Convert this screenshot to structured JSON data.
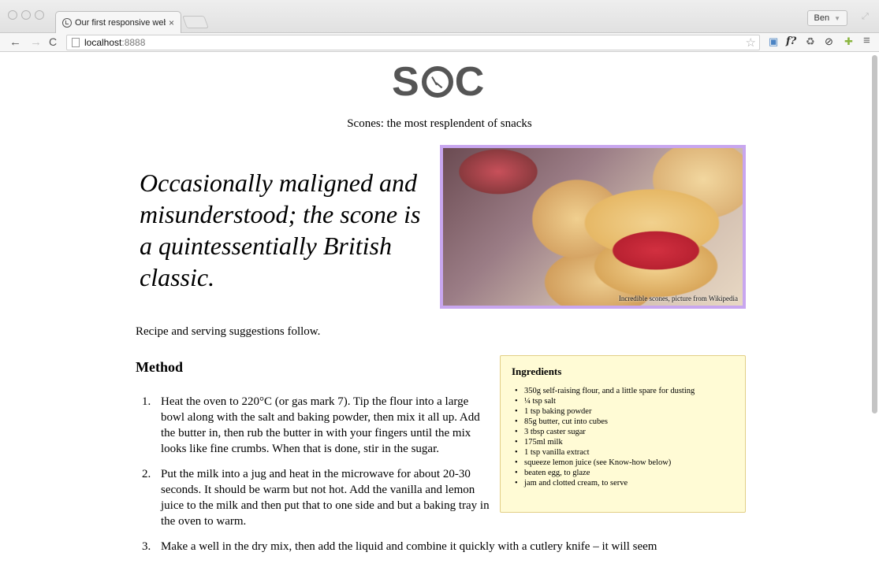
{
  "browser": {
    "tab_title": "Our first responsive web p",
    "tab_fade": "",
    "tab_close": "×",
    "user": "Ben",
    "url_host": "localhost",
    "url_port": ":8888",
    "icons": {
      "back": "back-arrow-icon",
      "forward": "forward-arrow-icon",
      "reload": "reload-icon",
      "bookmark": "star-icon",
      "menu": "hamburger-menu-icon"
    },
    "ext_label": "f?"
  },
  "page": {
    "logo": {
      "left": "S",
      "right": "C"
    },
    "tagline": "Scones: the most resplendent of snacks",
    "lede": "Occasionally maligned and misunderstood; the scone is a quintessentially British classic.",
    "hero_caption": "Incredible scones, picture from Wikipedia",
    "intro": "Recipe and serving suggestions follow.",
    "method_title": "Method",
    "steps": [
      {
        "num": "1.",
        "text": "Heat the oven to 220°C (or gas mark 7). Tip the flour into a large bowl along with the salt and baking powder, then mix it all up. Add the butter in, then rub the butter in with your fingers until the mix looks like fine crumbs. When that is done, stir in the sugar."
      },
      {
        "num": "2.",
        "text": "Put the milk into a jug and heat in the microwave for about 20-30 seconds. It should be warm but not hot. Add the vanilla and lemon juice to the milk and then put that to one side and but a baking tray in the oven to warm."
      },
      {
        "num": "3.",
        "text": "Make a well in the dry mix, then add the liquid and combine it quickly with a cutlery knife – it will seem"
      }
    ],
    "ingredients": {
      "title": "Ingredients",
      "items": [
        "350g self-raising flour, and a little spare for dusting",
        "¼ tsp salt",
        "1 tsp baking powder",
        "85g butter, cut into cubes",
        "3 tbsp caster sugar",
        "175ml milk",
        "1 tsp vanilla extract",
        "squeeze lemon juice (see Know-how below)",
        "beaten egg, to glaze",
        "jam and clotted cream, to serve"
      ]
    }
  }
}
